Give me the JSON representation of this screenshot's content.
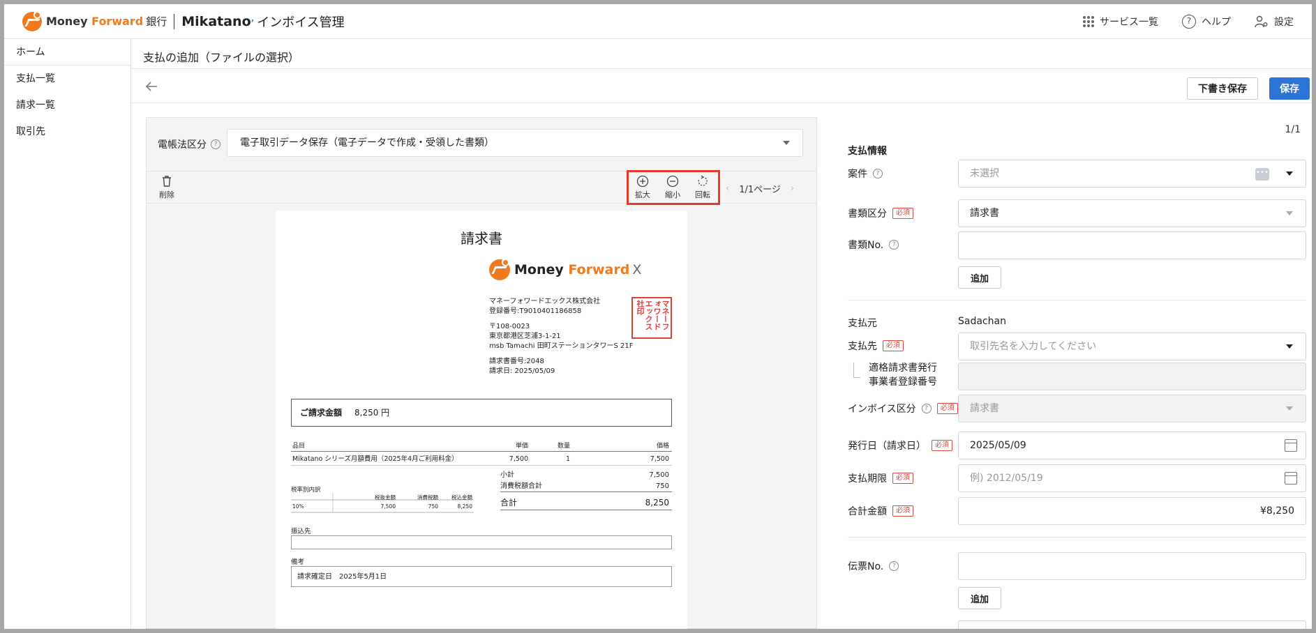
{
  "header": {
    "brand_money": "Money ",
    "brand_forward": "Forward",
    "brand_bank": "銀行",
    "product": "Mikatano",
    "product_sub": "インボイス管理",
    "services": "サービス一覧",
    "help": "ヘルプ",
    "settings": "設定"
  },
  "sidebar": {
    "items": [
      {
        "label": "ホーム"
      },
      {
        "label": "支払一覧"
      },
      {
        "label": "請求一覧"
      },
      {
        "label": "取引先"
      }
    ]
  },
  "page": {
    "title": "支払の追加（ファイルの選択）",
    "draft_button": "下書き保存",
    "save_button": "保存"
  },
  "viewer": {
    "law_label": "電帳法区分",
    "law_value": "電子取引データ保存（電子データで作成・受領した書類）",
    "delete": "削除",
    "zoom_in": "拡大",
    "zoom_out": "縮小",
    "rotate": "回転",
    "page_indicator": "1/1ページ"
  },
  "document": {
    "title": "請求書",
    "logo_money": "Money ",
    "logo_forward": "Forward",
    "logo_x": "X",
    "company": "マネーフォワードエックス株式会社",
    "reg_no": "登録番号:T9010401186858",
    "postal": "〒108-0023",
    "address1": "東京都港区芝浦3-1-21",
    "address2": "msb Tamachi 田町ステーションタワーS 21F",
    "invoice_no": "請求書番号:2048",
    "invoice_date": "請求日:       2025/05/09",
    "seal_text": "マネーフォワードエックス社印",
    "amount_label": "ご請求金額",
    "amount_value": "8,250 円",
    "table_headers": {
      "item": "品目",
      "unit_price": "単価",
      "qty": "数量",
      "price": "価格"
    },
    "rows": [
      {
        "item": "Mikatano シリーズ月額費用（2025年4月ご利用料金）",
        "unit_price": "7,500",
        "qty": "1",
        "price": "7,500"
      }
    ],
    "subtotal_label": "小計",
    "subtotal": "7,500",
    "tax_label": "消費税額合計",
    "tax": "750",
    "total_label": "合計",
    "total": "8,250",
    "tax_breakdown_title": "税率別内訳",
    "tax_headers": {
      "excl": "税抜金額",
      "tax": "消費税額",
      "incl": "税込金額"
    },
    "tax_row": {
      "rate": "10%",
      "excl": "7,500",
      "tax": "750",
      "incl": "8,250"
    },
    "bank_label": "振込先",
    "notes_label": "備考",
    "notes_value": "請求確定日　2025年5月1日"
  },
  "form": {
    "pager": "1/1",
    "section_title": "支払情報",
    "project_label": "案件",
    "project_placeholder": "未選択",
    "doc_type_label": "書類区分",
    "doc_type_value": "請求書",
    "doc_no_label": "書類No.",
    "add_label": "追加",
    "payer_label": "支払元",
    "payer_value": "Sadachan",
    "payee_label": "支払先",
    "payee_placeholder": "取引先名を入力してください",
    "reg_label_1": "適格請求書発行",
    "reg_label_2": "事業者登録番号",
    "invoice_type_label": "インボイス区分",
    "invoice_type_value": "請求書",
    "issue_date_label": "発行日（請求日）",
    "issue_date_value": "2025/05/09",
    "due_label": "支払期限",
    "due_placeholder": "例) 2012/05/19",
    "total_label": "合計金額",
    "total_value": "¥8,250",
    "slip_label": "伝票No.",
    "add_label_2": "追加",
    "required": "必須"
  }
}
